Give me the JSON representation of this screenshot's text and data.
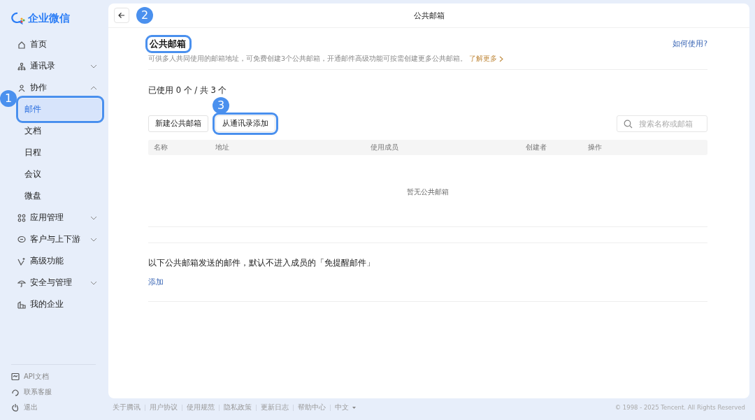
{
  "sidebar": {
    "logo": "企业微信",
    "items": [
      {
        "label": "首页",
        "selected": false
      },
      {
        "label": "通讯录",
        "expanded": false,
        "selected": false
      },
      {
        "label": "协作",
        "expanded": true,
        "selected": false,
        "children": [
          {
            "label": "邮件",
            "selected": true
          },
          {
            "label": "文档",
            "selected": false
          },
          {
            "label": "日程",
            "selected": false
          },
          {
            "label": "会议",
            "selected": false
          },
          {
            "label": "微盘",
            "selected": false
          }
        ]
      },
      {
        "label": "应用管理",
        "expanded": false,
        "selected": false
      },
      {
        "label": "客户与上下游",
        "expanded": false,
        "selected": false
      },
      {
        "label": "高级功能",
        "selected": false
      },
      {
        "label": "安全与管理",
        "expanded": false,
        "selected": false
      },
      {
        "label": "我的企业",
        "selected": false
      }
    ],
    "bottom_links": [
      "API文档",
      "联系客服",
      "退出"
    ]
  },
  "header": {
    "title": "公共邮箱"
  },
  "page": {
    "title": "公共邮箱",
    "help_link": "如何使用?",
    "description": "可供多人共同使用的邮箱地址，可免费创建3个公共邮箱，开通邮件高级功能可按需创建更多公共邮箱。",
    "learn_more": "了解更多",
    "usage": "已使用 0 个 / 共 3 个",
    "buttons": [
      "新建公共邮箱",
      "从通讯录添加"
    ],
    "search": {
      "placeholder": "搜索名称或邮箱"
    },
    "table": {
      "columns": [
        "名称",
        "地址",
        "使用成员",
        "创建者",
        "操作"
      ],
      "empty_text": "暂无公共邮箱"
    },
    "reminder_text": "以下公共邮箱发送的邮件，默认不进入成员的「免提醒邮件」",
    "add_link": "添加"
  },
  "footer": {
    "links": [
      "关于腾讯",
      "用户协议",
      "使用规范",
      "隐私政策",
      "更新日志",
      "帮助中心"
    ],
    "language": "中文",
    "copyright": "© 1998 - 2025 Tencent. All Rights Reserved"
  },
  "annotations": [
    "1",
    "2",
    "3"
  ]
}
